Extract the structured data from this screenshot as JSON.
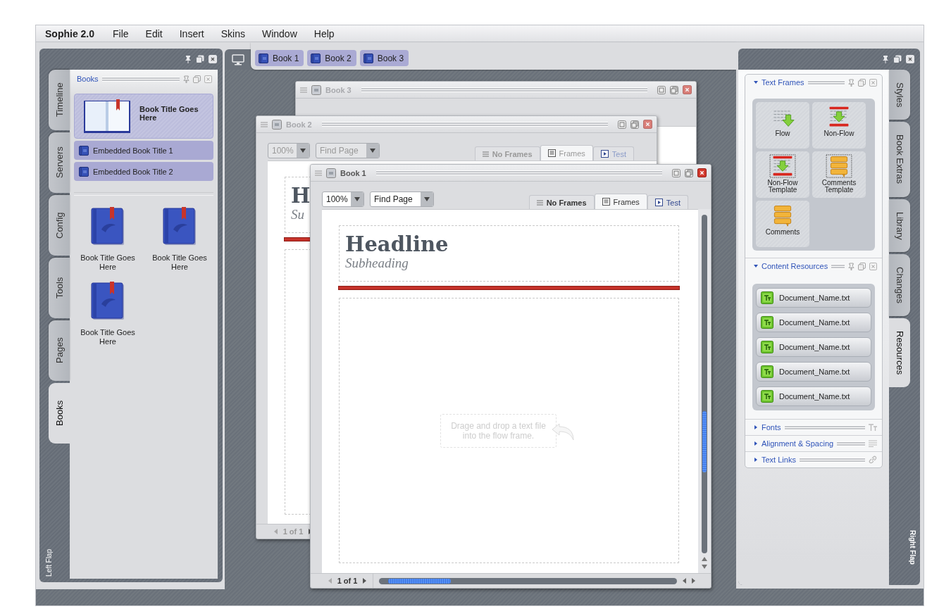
{
  "app": {
    "name": "Sophie 2.0"
  },
  "menus": [
    {
      "label": "File"
    },
    {
      "label": "Edit"
    },
    {
      "label": "Insert"
    },
    {
      "label": "Skins"
    },
    {
      "label": "Window"
    },
    {
      "label": "Help"
    }
  ],
  "left_flap": {
    "label": "Left Flap",
    "tabs": [
      {
        "label": "Timeline",
        "selected": false
      },
      {
        "label": "Servers",
        "selected": false
      },
      {
        "label": "Config",
        "selected": false
      },
      {
        "label": "Tools",
        "selected": false
      },
      {
        "label": "Pages",
        "selected": false
      },
      {
        "label": "Books",
        "selected": true
      }
    ],
    "panel": {
      "title": "Books",
      "current": {
        "title": "Book Title Goes Here"
      },
      "embedded": [
        {
          "title": "Embedded Book Title 1"
        },
        {
          "title": "Embedded Book Title 2"
        }
      ],
      "books": [
        {
          "title": "Book Title Goes Here"
        },
        {
          "title": "Book Title Goes Here"
        },
        {
          "title": "Book Title Goes Here"
        }
      ]
    }
  },
  "desktop": {
    "tabs": [
      {
        "label": "Book 1"
      },
      {
        "label": "Book 2"
      },
      {
        "label": "Book 3"
      }
    ],
    "windows": [
      {
        "title": "Book 3",
        "active": false
      },
      {
        "title": "Book 2",
        "active": false,
        "zoom": "100%",
        "find_page": "Find Page",
        "view_tabs": [
          {
            "label": "No Frames",
            "kind": "list",
            "selected": false
          },
          {
            "label": "Frames",
            "kind": "frames",
            "selected": true
          },
          {
            "label": "Test",
            "kind": "test",
            "selected": false
          }
        ],
        "headline": "H",
        "subheading": "Su",
        "page_status": "1 of 1"
      },
      {
        "title": "Book 1",
        "active": true,
        "zoom": "100%",
        "find_page": "Find Page",
        "view_tabs": [
          {
            "label": "No Frames",
            "kind": "list",
            "selected": false
          },
          {
            "label": "Frames",
            "kind": "frames",
            "selected": true
          },
          {
            "label": "Test",
            "kind": "test",
            "selected": false
          }
        ],
        "headline": "Headline",
        "subheading": "Subheading",
        "hint": "Drage and drop a text file into the flow frame.",
        "page_status": "1 of 1"
      }
    ]
  },
  "right_flap": {
    "label": "Right Flap",
    "tabs": [
      {
        "label": "Styles",
        "selected": false
      },
      {
        "label": "Book Extras",
        "selected": false
      },
      {
        "label": "Library",
        "selected": false
      },
      {
        "label": "Changes",
        "selected": false
      },
      {
        "label": "Resources",
        "selected": true
      }
    ],
    "sections": [
      {
        "kind": "frames",
        "title": "Text Frames",
        "expanded": true,
        "items": [
          {
            "label": "Flow",
            "kind": "flow"
          },
          {
            "label": "Non-Flow",
            "kind": "non_flow"
          },
          {
            "label": "Non-Flow Template",
            "kind": "non_flow_template"
          },
          {
            "label": "Comments Template",
            "kind": "comments_template"
          },
          {
            "label": "Comments",
            "kind": "comments"
          }
        ]
      },
      {
        "kind": "resources",
        "title": "Content Resources",
        "expanded": true,
        "items": [
          {
            "name": "Document_Name.txt"
          },
          {
            "name": "Document_Name.txt"
          },
          {
            "name": "Document_Name.txt"
          },
          {
            "name": "Document_Name.txt"
          },
          {
            "name": "Document_Name.txt"
          }
        ]
      },
      {
        "kind": "fonts",
        "title": "Fonts",
        "expanded": false
      },
      {
        "kind": "alignment",
        "title": "Alignment & Spacing",
        "expanded": false
      },
      {
        "kind": "links",
        "title": "Text Links",
        "expanded": false
      }
    ]
  }
}
